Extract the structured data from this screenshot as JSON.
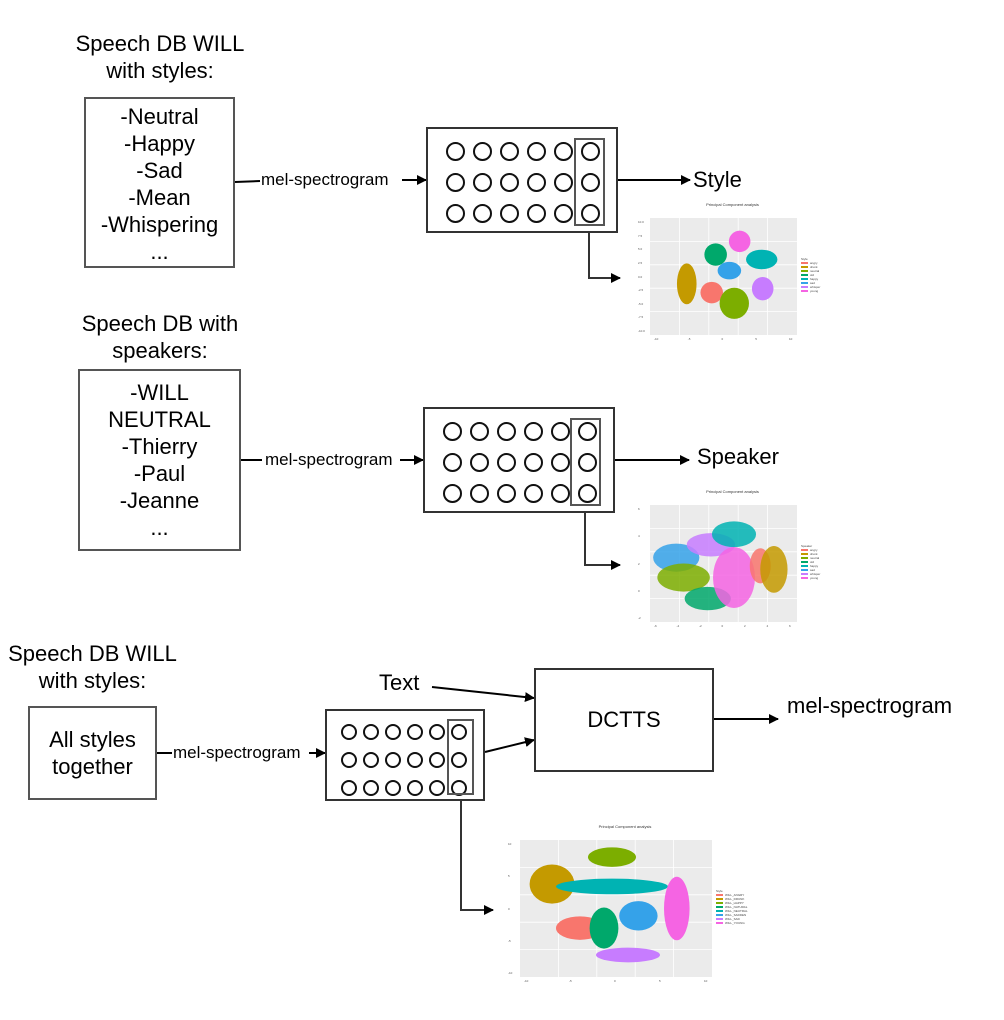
{
  "row1": {
    "title": "Speech DB WILL\nwith styles:",
    "items": [
      "-Neutral",
      "-Happy",
      "-Sad",
      "-Mean",
      "-Whispering",
      "..."
    ],
    "edge_label": "mel-spectrogram",
    "output_label": "Style",
    "plot": {
      "title": "Principal Component analysis",
      "legend_title": "Style",
      "legend": [
        {
          "name": "angry",
          "color": "#f8766d"
        },
        {
          "name": "drunk",
          "color": "#c49a00"
        },
        {
          "name": "neutral",
          "color": "#7cae00"
        },
        {
          "name": "old",
          "color": "#00a86b"
        },
        {
          "name": "happy",
          "color": "#00b3b3"
        },
        {
          "name": "sad",
          "color": "#35a2e9"
        },
        {
          "name": "whisper",
          "color": "#c77cff"
        },
        {
          "name": "young",
          "color": "#f564e3"
        }
      ],
      "y_ticks": [
        "10.0",
        "7.5",
        "5.0",
        "2.5",
        "0.0",
        "-2.5",
        "-5.0",
        "-7.5",
        "-10.0"
      ],
      "x_ticks": [
        "-10",
        "-5",
        "0",
        "5",
        "10"
      ]
    }
  },
  "row2": {
    "title": "Speech DB with\nspeakers:",
    "items": [
      "-WILL",
      "NEUTRAL",
      "-Thierry",
      "-Paul",
      "-Jeanne",
      "..."
    ],
    "edge_label": "mel-spectrogram",
    "output_label": "Speaker",
    "plot": {
      "title": "Principal Component analysis",
      "legend_title": "Speaker",
      "legend": [
        {
          "name": "angry",
          "color": "#f8766d"
        },
        {
          "name": "drunk",
          "color": "#c49a00"
        },
        {
          "name": "neutral",
          "color": "#7cae00"
        },
        {
          "name": "old",
          "color": "#00a86b"
        },
        {
          "name": "happy",
          "color": "#00b3b3"
        },
        {
          "name": "sad",
          "color": "#35a2e9"
        },
        {
          "name": "whisper",
          "color": "#c77cff"
        },
        {
          "name": "young",
          "color": "#f564e3"
        }
      ],
      "y_ticks": [
        "6",
        "4",
        "2",
        "0",
        "-2"
      ],
      "x_ticks": [
        "-6",
        "-4",
        "-2",
        "0",
        "2",
        "4",
        "6"
      ]
    }
  },
  "row3": {
    "title": "Speech DB WILL\nwith styles:",
    "box_text": "All styles\ntogether",
    "edge_label": "mel-spectrogram",
    "text_input_label": "Text",
    "model_label": "DCTTS",
    "output_label": "mel-spectrogram",
    "plot": {
      "title": "Principal Component analysis",
      "legend_title": "Style",
      "legend": [
        {
          "name": "WILL_ANGRY",
          "color": "#f8766d"
        },
        {
          "name": "WILL_DRUNK",
          "color": "#c49a00"
        },
        {
          "name": "WILL_HAPPY",
          "color": "#7cae00"
        },
        {
          "name": "WILL_NATURAL",
          "color": "#00a86b"
        },
        {
          "name": "WILL_NEUTRAL",
          "color": "#00b3b3"
        },
        {
          "name": "WILL_SADDEN",
          "color": "#35a2e9"
        },
        {
          "name": "WILL_SAD",
          "color": "#c77cff"
        },
        {
          "name": "WILL_YOUNG",
          "color": "#f564e3"
        }
      ],
      "y_ticks": [
        "10",
        "5",
        "0",
        "-5",
        "-10"
      ],
      "x_ticks": [
        "-10",
        "-5",
        "0",
        "5",
        "10"
      ]
    }
  }
}
